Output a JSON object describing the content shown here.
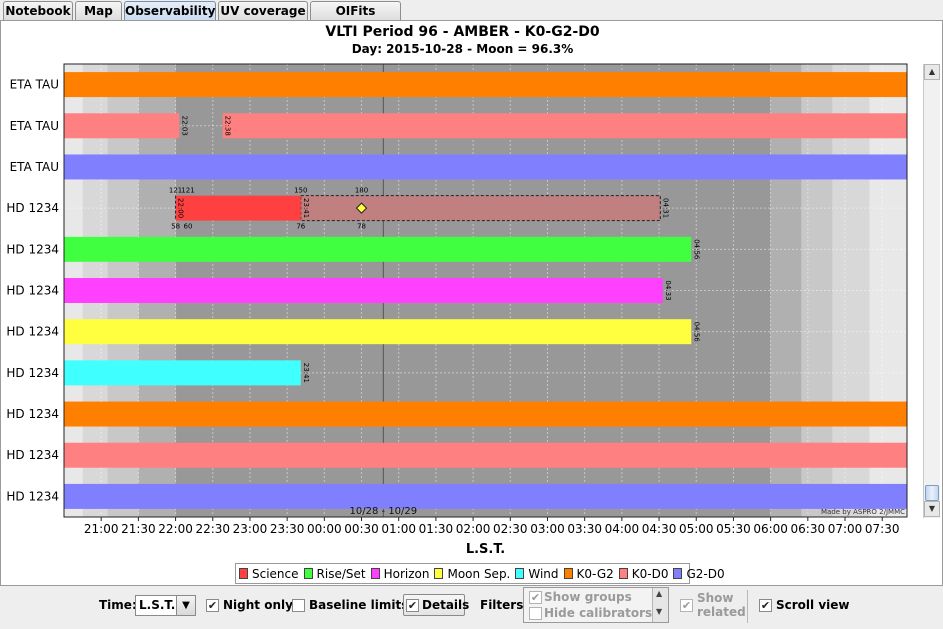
{
  "tabs": [
    {
      "label": "Notebook",
      "active": false
    },
    {
      "label": "Map",
      "active": false
    },
    {
      "label": "Observability",
      "active": true
    },
    {
      "label": "UV coverage",
      "active": false
    },
    {
      "label": "OIFits viewer",
      "active": false
    }
  ],
  "chart_data": {
    "type": "timeline",
    "title": "VLTI Period 96 - AMBER - K0-G2-D0",
    "subtitle": "Day: 2015-10-28 - Moon = 96.3%",
    "xlabel": "L.S.T.",
    "x_ticks": [
      "21:00",
      "21:30",
      "22:00",
      "22:30",
      "23:00",
      "23:30",
      "00:00",
      "00:30",
      "01:00",
      "01:30",
      "02:00",
      "02:30",
      "03:00",
      "03:30",
      "04:00",
      "04:30",
      "05:00",
      "05:30",
      "06:00",
      "06:30",
      "07:00",
      "07:30"
    ],
    "date_marker": "10/28 - 10/29",
    "watermark": "Made by ASPRO 2/JMMC",
    "rows": [
      {
        "label": "ETA TAU",
        "color": "#ff8000",
        "segments": [
          {
            "start": "20:30",
            "end": "07:50"
          }
        ],
        "marks": []
      },
      {
        "label": "ETA TAU",
        "color": "#ff8080",
        "segments": [
          {
            "start": "20:30",
            "end": "22:03"
          },
          {
            "start": "22:38",
            "end": "07:50"
          }
        ],
        "marks": [
          {
            "t": "22:03",
            "text": "22:03"
          },
          {
            "t": "22:38",
            "text": "22:38"
          }
        ]
      },
      {
        "label": "ETA TAU",
        "color": "#8080ff",
        "segments": [
          {
            "start": "20:30",
            "end": "07:50"
          }
        ],
        "marks": []
      },
      {
        "label": "HD 1234",
        "color": "#ff4040",
        "segments": [
          {
            "start": "22:00",
            "end": "23:41"
          }
        ],
        "transit": {
          "start": "23:41",
          "end": "04:31",
          "color": "#c08080"
        },
        "star": "00:30",
        "marks": [
          {
            "t": "22:00",
            "text": "22:00"
          },
          {
            "t": "23:41",
            "text": "23:41"
          },
          {
            "t": "04:31",
            "text": "04:31"
          }
        ],
        "top_labels": [
          {
            "t": "22:00",
            "text": "121"
          },
          {
            "t": "22:10",
            "text": "121"
          },
          {
            "t": "23:41",
            "text": "150"
          },
          {
            "t": "00:30",
            "text": "180"
          }
        ],
        "bottom_labels": [
          {
            "t": "22:00",
            "text": "58"
          },
          {
            "t": "22:10",
            "text": "60"
          },
          {
            "t": "23:41",
            "text": "76"
          },
          {
            "t": "00:30",
            "text": "78"
          }
        ]
      },
      {
        "label": "HD 1234",
        "color": "#40ff40",
        "segments": [
          {
            "start": "20:30",
            "end": "04:56"
          }
        ],
        "marks": [
          {
            "t": "04:56",
            "text": "04:56"
          }
        ]
      },
      {
        "label": "HD 1234",
        "color": "#ff40ff",
        "segments": [
          {
            "start": "20:30",
            "end": "04:33"
          }
        ],
        "marks": [
          {
            "t": "04:33",
            "text": "04:33"
          }
        ]
      },
      {
        "label": "HD 1234",
        "color": "#ffff40",
        "segments": [
          {
            "start": "20:30",
            "end": "04:56"
          }
        ],
        "marks": [
          {
            "t": "04:56",
            "text": "04:56"
          }
        ]
      },
      {
        "label": "HD 1234",
        "color": "#40ffff",
        "segments": [
          {
            "start": "20:30",
            "end": "23:41"
          }
        ],
        "marks": [
          {
            "t": "23:41",
            "text": "23:41"
          }
        ]
      },
      {
        "label": "HD 1234",
        "color": "#ff8000",
        "segments": [
          {
            "start": "20:30",
            "end": "07:50"
          }
        ],
        "marks": []
      },
      {
        "label": "HD 1234",
        "color": "#ff8080",
        "segments": [
          {
            "start": "20:30",
            "end": "07:50"
          }
        ],
        "marks": []
      },
      {
        "label": "HD 1234",
        "color": "#8080ff",
        "segments": [
          {
            "start": "20:30",
            "end": "07:50"
          }
        ],
        "marks": []
      }
    ],
    "night_shading": [
      {
        "start": "20:30",
        "end": "20:45",
        "color": "#e8e8e8"
      },
      {
        "start": "20:45",
        "end": "21:05",
        "color": "#d8d8d8"
      },
      {
        "start": "21:05",
        "end": "21:30",
        "color": "#c8c8c8"
      },
      {
        "start": "21:30",
        "end": "22:00",
        "color": "#b0b0b0"
      },
      {
        "start": "22:00",
        "end": "06:00",
        "color": "#989898"
      },
      {
        "start": "06:00",
        "end": "06:25",
        "color": "#b0b0b0"
      },
      {
        "start": "06:25",
        "end": "06:50",
        "color": "#c8c8c8"
      },
      {
        "start": "06:50",
        "end": "07:20",
        "color": "#d8d8d8"
      },
      {
        "start": "07:20",
        "end": "07:50",
        "color": "#e8e8e8"
      }
    ],
    "legend": [
      {
        "label": "Science",
        "color": "#ff4040"
      },
      {
        "label": "Rise/Set",
        "color": "#40ff40"
      },
      {
        "label": "Horizon",
        "color": "#ff40ff"
      },
      {
        "label": "Moon Sep.",
        "color": "#ffff40"
      },
      {
        "label": "Wind",
        "color": "#40ffff"
      },
      {
        "label": "K0-G2",
        "color": "#ff8000"
      },
      {
        "label": "K0-D0",
        "color": "#ff8080"
      },
      {
        "label": "G2-D0",
        "color": "#8080ff"
      }
    ]
  },
  "toolbar": {
    "time_label": "Time:",
    "time_value": "L.S.T.",
    "night_only": {
      "label": "Night only",
      "checked": true
    },
    "baseline_limits": {
      "label": "Baseline limits",
      "checked": false
    },
    "details": {
      "label": "Details",
      "checked": true
    },
    "filters_label": "Filters:",
    "filters": [
      {
        "label": "Show groups",
        "checked": true
      },
      {
        "label": "Hide calibrators",
        "checked": false
      }
    ],
    "show_related": {
      "label_line1": "Show",
      "label_line2": "related",
      "checked": true
    },
    "scroll_view": {
      "label": "Scroll view",
      "checked": true
    }
  }
}
